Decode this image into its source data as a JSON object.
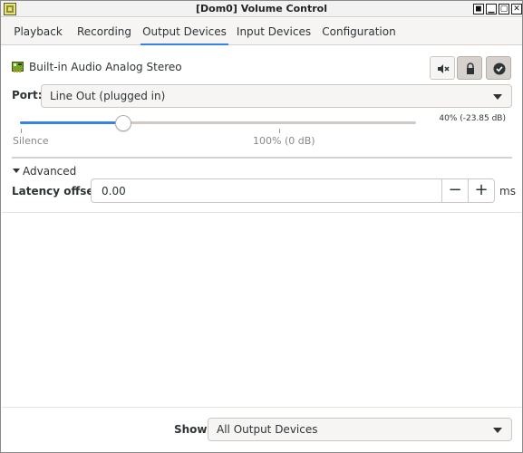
{
  "window": {
    "title": "[Dom0] Volume Control",
    "app_icon": "volume-control-icon",
    "buttons": [
      "sticky-icon",
      "minimize-icon",
      "maximize-icon",
      "close-icon"
    ]
  },
  "tabs": [
    {
      "label": "Playback",
      "active": false
    },
    {
      "label": "Recording",
      "active": false
    },
    {
      "label": "Output Devices",
      "active": true
    },
    {
      "label": "Input Devices",
      "active": false
    },
    {
      "label": "Configuration",
      "active": false
    }
  ],
  "device": {
    "icon": "sound-card-icon",
    "name": "Built-in Audio Analog Stereo",
    "mute_icon": "mute-icon",
    "lock_icon": "lock-icon",
    "default_icon": "checkmark-icon",
    "default_pressed": true
  },
  "port": {
    "label": "Port:",
    "value": "Line Out (plugged in)"
  },
  "volume": {
    "percent_text": "40% (-23.85 dB)",
    "level": 0.4,
    "silence_label": "Silence",
    "normal_label": "100% (0 dB)"
  },
  "advanced": {
    "label": "Advanced",
    "latency_label": "Latency offset:",
    "latency_value": "0.00",
    "unit": "ms",
    "minus": "−",
    "plus": "+"
  },
  "footer": {
    "show_label": "Show:",
    "show_value": "All Output Devices"
  },
  "colors": {
    "accent": "#3584e4",
    "icon_green": "#4e9a06"
  }
}
